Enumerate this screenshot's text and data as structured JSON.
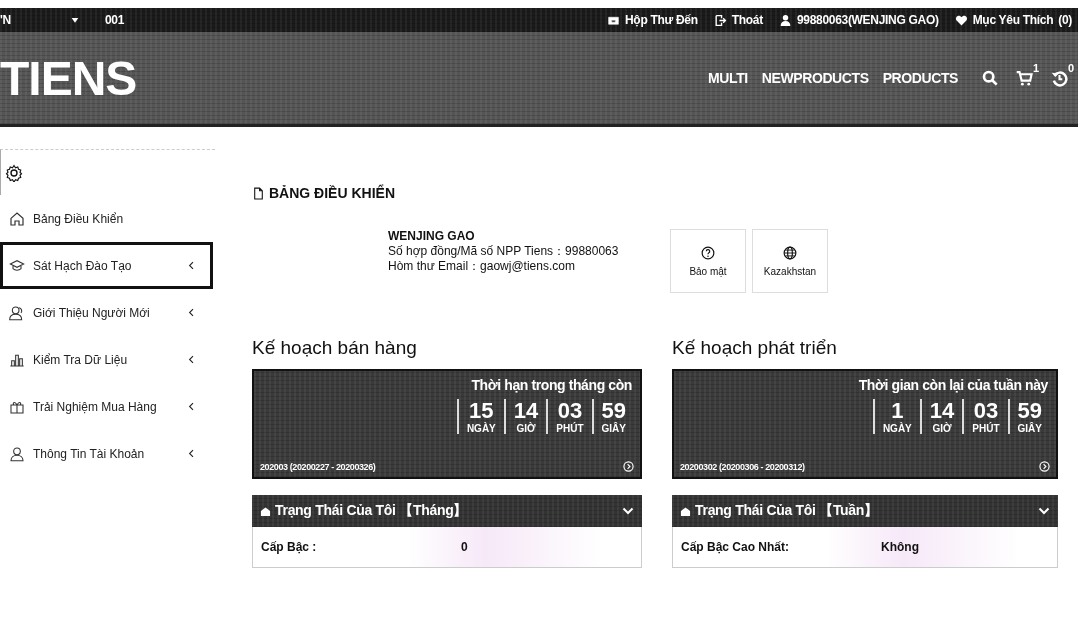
{
  "top_bar": {
    "language": "'N",
    "account_code": "001",
    "links": [
      {
        "kind": "inbox",
        "label": "Hộp Thư Đến"
      },
      {
        "kind": "logout",
        "label": "Thoát"
      },
      {
        "kind": "user",
        "label": "99880063(WENJING GAO)"
      },
      {
        "kind": "favorites",
        "label": "Mục Yêu Thích",
        "count": "(0)"
      }
    ]
  },
  "header": {
    "logo": "TIENS",
    "nav": [
      "MULTI",
      "NEWPRODUCTS",
      "PRODUCTS"
    ],
    "cart_count": "1",
    "history_count": "0"
  },
  "sidebar": {
    "items": [
      {
        "label": "Bảng Điều Khiển",
        "selected": false,
        "has_submenu": false
      },
      {
        "label": "Sát Hạch Đào Tạo",
        "selected": true,
        "has_submenu": true
      },
      {
        "label": "Giới Thiệu Người Mới",
        "selected": false,
        "has_submenu": true
      },
      {
        "label": "Kiểm Tra Dữ Liệu",
        "selected": false,
        "has_submenu": true
      },
      {
        "label": "Trải Nghiệm Mua Hàng",
        "selected": false,
        "has_submenu": true
      },
      {
        "label": "Thông Tin Tài Khoản",
        "selected": false,
        "has_submenu": true
      }
    ]
  },
  "dashboard": {
    "title": "BẢNG ĐIỀU KHIỂN",
    "profile": {
      "name": "WENJING GAO",
      "lines": [
        "Số hợp đồng/Mã số NPP Tiens：99880063",
        "Hòm thư Email：gaowj@tiens.com"
      ]
    },
    "quick_buttons": [
      {
        "kind": "help",
        "label": "Bảo mật"
      },
      {
        "kind": "globe",
        "label": "Kazakhstan"
      }
    ]
  },
  "plans": [
    {
      "title": "Kế hoạch bán hàng",
      "countdown_title": "Thời hạn trong tháng còn",
      "units": [
        {
          "value": "15",
          "label": "NGÀY"
        },
        {
          "value": "14",
          "label": "GIỜ"
        },
        {
          "value": "03",
          "label": "PHÚT"
        },
        {
          "value": "59",
          "label": "GIÂY"
        }
      ],
      "period": "202003 (20200227 - 20200326)",
      "status_title": "Trạng Thái Của Tôi 【Tháng】",
      "status_rows": [
        {
          "label": "Cấp Bậc :",
          "value": "0"
        }
      ]
    },
    {
      "title": "Kế hoạch phát triển",
      "countdown_title": "Thời gian còn lại của tuần này",
      "units": [
        {
          "value": "1",
          "label": "NGÀY"
        },
        {
          "value": "14",
          "label": "GIỜ"
        },
        {
          "value": "03",
          "label": "PHÚT"
        },
        {
          "value": "59",
          "label": "GIÂY"
        }
      ],
      "period": "20200302 (20200306 - 20200312)",
      "status_title": "Trạng Thái Của Tôi 【Tuần】",
      "status_rows": [
        {
          "label": "Cấp Bậc Cao Nhất:",
          "value": "Không"
        }
      ]
    }
  ]
}
